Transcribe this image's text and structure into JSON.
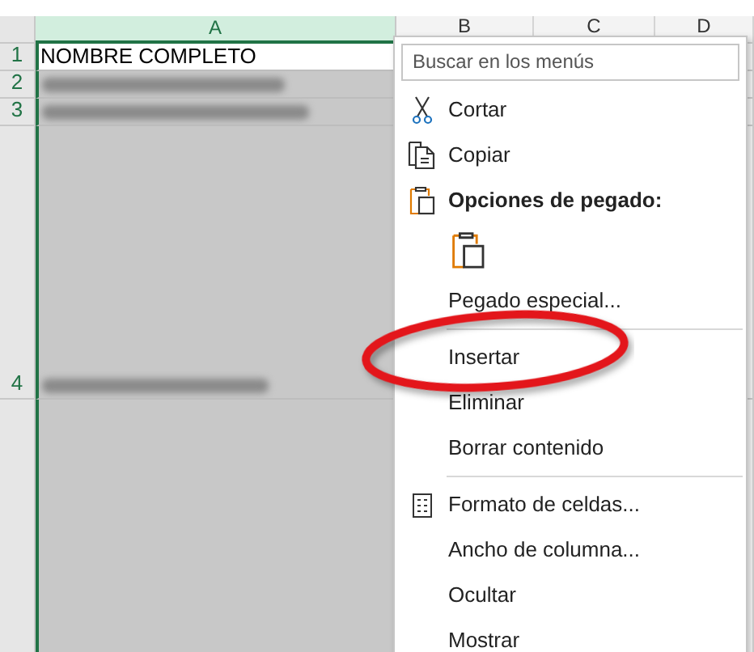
{
  "sheet": {
    "columns": [
      {
        "label": "A",
        "selected": true
      },
      {
        "label": "B",
        "selected": false
      },
      {
        "label": "C",
        "selected": false
      },
      {
        "label": "D",
        "selected": false
      }
    ],
    "rows": [
      {
        "number": "1",
        "cells": [
          {
            "kind": "text",
            "text": "NOMBRE COMPLETO"
          }
        ]
      },
      {
        "number": "2",
        "cells": [
          {
            "kind": "redacted"
          }
        ]
      },
      {
        "number": "3",
        "cells": [
          {
            "kind": "redacted"
          }
        ]
      },
      {
        "number": "4",
        "cells": [
          {
            "kind": "redacted"
          }
        ]
      }
    ]
  },
  "context_menu": {
    "search": {
      "placeholder": "Buscar en los menús"
    },
    "items": [
      {
        "kind": "cut",
        "label": "Cortar"
      },
      {
        "kind": "copy",
        "label": "Copiar"
      },
      {
        "kind": "paste-heading",
        "label": "Opciones de pegado:"
      },
      {
        "kind": "paste-button"
      },
      {
        "kind": "item",
        "label": "Pegado especial..."
      },
      {
        "kind": "separator"
      },
      {
        "kind": "item",
        "label": "Insertar"
      },
      {
        "kind": "item",
        "label": "Eliminar"
      },
      {
        "kind": "item",
        "label": "Borrar contenido"
      },
      {
        "kind": "separator"
      },
      {
        "kind": "format-cells",
        "label": "Formato de celdas..."
      },
      {
        "kind": "item",
        "label": "Ancho de columna..."
      },
      {
        "kind": "item",
        "label": "Ocultar"
      },
      {
        "kind": "item",
        "label": "Mostrar"
      }
    ]
  }
}
